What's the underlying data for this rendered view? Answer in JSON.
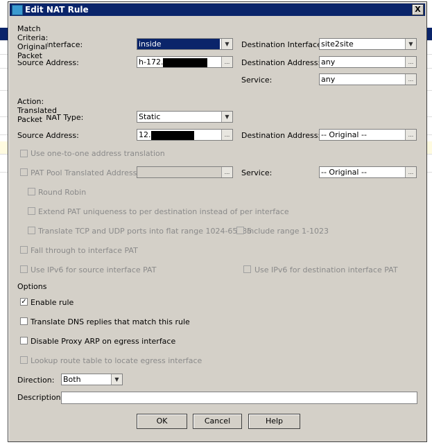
{
  "dialog": {
    "title": "Edit NAT Rule",
    "close": "X"
  },
  "match": {
    "heading": "Match Criteria: Original Packet",
    "source_interface_label": "Source Interface:",
    "source_interface": "inside",
    "destination_interface_label": "Destination Interface:",
    "destination_interface": "site2site",
    "source_address_label": "Source Address:",
    "source_address": "h-172.",
    "destination_address_label": "Destination Address:",
    "destination_address": "any",
    "service_label": "Service:",
    "service": "any"
  },
  "action": {
    "heading": "Action: Translated Packet",
    "nat_type_label": "Source NAT Type:",
    "nat_type": "Static",
    "source_address_label": "Source Address:",
    "source_address": "12.",
    "destination_address_label": "Destination Address:",
    "destination_address": "-- Original --",
    "one_to_one": "Use one-to-one address translation",
    "pat_pool": "PAT Pool Translated Address:",
    "service_label": "Service:",
    "service": "-- Original --",
    "round_robin": "Round Robin",
    "extend_pat": "Extend PAT uniqueness to per destination instead of per interface",
    "translate_ports": "Translate TCP and UDP ports into flat range 1024-65535",
    "include_range": "Include range 1-1023",
    "fall_through": "Fall through to interface PAT",
    "ipv6_source": "Use IPv6 for source interface PAT",
    "ipv6_dest": "Use IPv6 for destination interface PAT"
  },
  "options": {
    "heading": "Options",
    "enable_rule": "Enable rule",
    "enable_rule_checked": true,
    "translate_dns": "Translate DNS replies that match this rule",
    "disable_proxy_arp": "Disable Proxy ARP on egress interface",
    "lookup_route": "Lookup route table to locate egress interface",
    "direction_label": "Direction:",
    "direction": "Both",
    "description_label": "Description:",
    "description": ""
  },
  "buttons": {
    "ok": "OK",
    "cancel": "Cancel",
    "help": "Help"
  },
  "icons": {
    "dropdown": "▼",
    "browse": "..."
  }
}
